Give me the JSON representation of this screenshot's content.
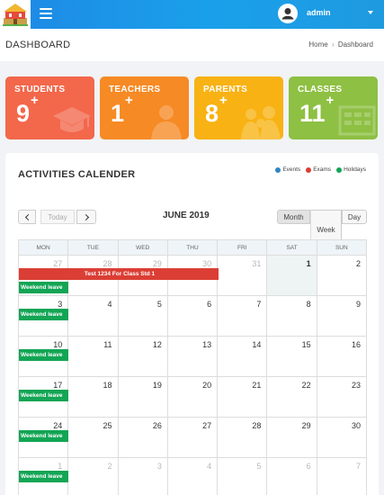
{
  "topbar": {
    "username": "admin"
  },
  "header": {
    "title": "DASHBOARD",
    "breadcrumb": [
      "Home",
      "Dashboard"
    ]
  },
  "cards": [
    {
      "label": "STUDENTS",
      "count": "9",
      "plus": "+",
      "color": "#f3674b"
    },
    {
      "label": "TEACHERS",
      "count": "1",
      "plus": "+",
      "color": "#f68a25"
    },
    {
      "label": "PARENTS",
      "count": "8",
      "plus": "+",
      "color": "#f8b213"
    },
    {
      "label": "CLASSES",
      "count": "11",
      "plus": "+",
      "color": "#8ec043"
    }
  ],
  "calendar": {
    "title": "ACTIVITIES CALENDER",
    "legend": [
      {
        "label": "Events",
        "color": "#2e86c1"
      },
      {
        "label": "Exams",
        "color": "#db3e35"
      },
      {
        "label": "Holidays",
        "color": "#12a554"
      }
    ],
    "today_label": "Today",
    "month_label": "JUNE 2019",
    "views": [
      "Month",
      "Week",
      "Day"
    ],
    "days_of_week": [
      "MON",
      "TUE",
      "WED",
      "THU",
      "FRI",
      "SAT",
      "SUN"
    ],
    "weeks": [
      [
        "27",
        "28",
        "29",
        "30",
        "31",
        "1",
        "2"
      ],
      [
        "3",
        "4",
        "5",
        "6",
        "7",
        "8",
        "9"
      ],
      [
        "10",
        "11",
        "12",
        "13",
        "14",
        "15",
        "16"
      ],
      [
        "17",
        "18",
        "19",
        "20",
        "21",
        "22",
        "23"
      ],
      [
        "24",
        "25",
        "26",
        "27",
        "28",
        "29",
        "30"
      ],
      [
        "1",
        "2",
        "3",
        "4",
        "5",
        "6",
        "7"
      ]
    ],
    "exam_event": "Test 1234 For Class Std 1",
    "holiday_event": "Weekend leave"
  }
}
